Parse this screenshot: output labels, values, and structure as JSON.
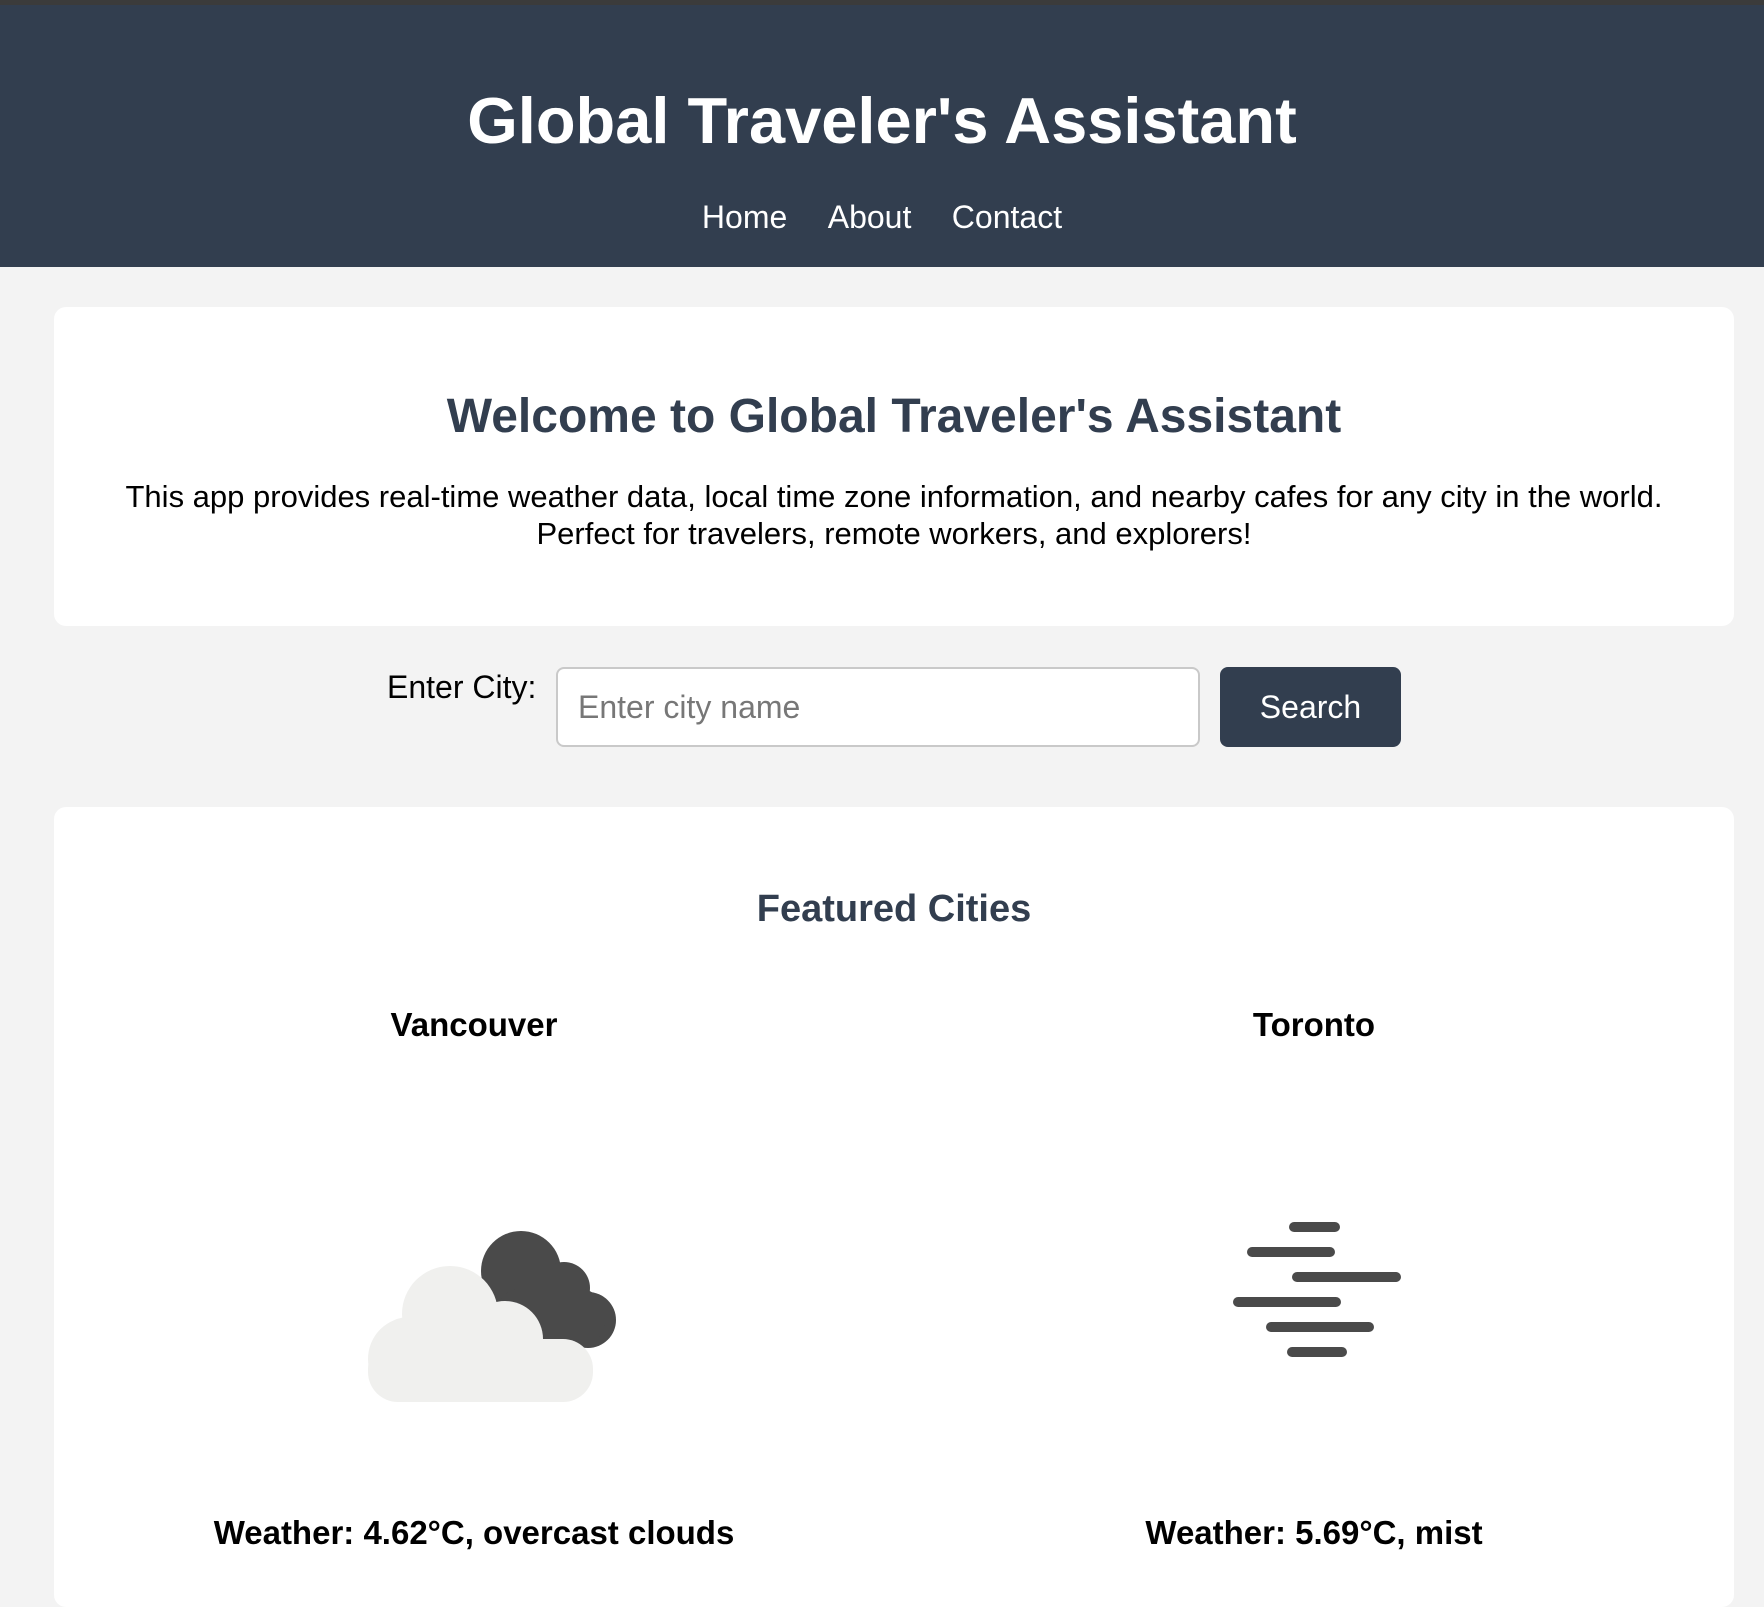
{
  "header": {
    "title": "Global Traveler's Assistant",
    "nav": [
      "Home",
      "About",
      "Contact"
    ]
  },
  "intro": {
    "title": "Welcome to Global Traveler's Assistant",
    "text_line1": "This app provides real-time weather data, local time zone information, and nearby cafes for any city in the world.",
    "text_line2": "Perfect for travelers, remote workers, and explorers!"
  },
  "search": {
    "label": "Enter City:",
    "placeholder": "Enter city name",
    "button": "Search"
  },
  "featured": {
    "title": "Featured Cities",
    "cities": [
      {
        "name": "Vancouver",
        "icon": "overcast-clouds-icon",
        "weather": "Weather: 4.62°C, overcast clouds"
      },
      {
        "name": "Toronto",
        "icon": "mist-icon",
        "weather": "Weather: 5.69°C, mist"
      }
    ]
  },
  "colors": {
    "header_bg": "#323e4f",
    "page_bg": "#f3f3f3",
    "accent": "#323e4f"
  }
}
